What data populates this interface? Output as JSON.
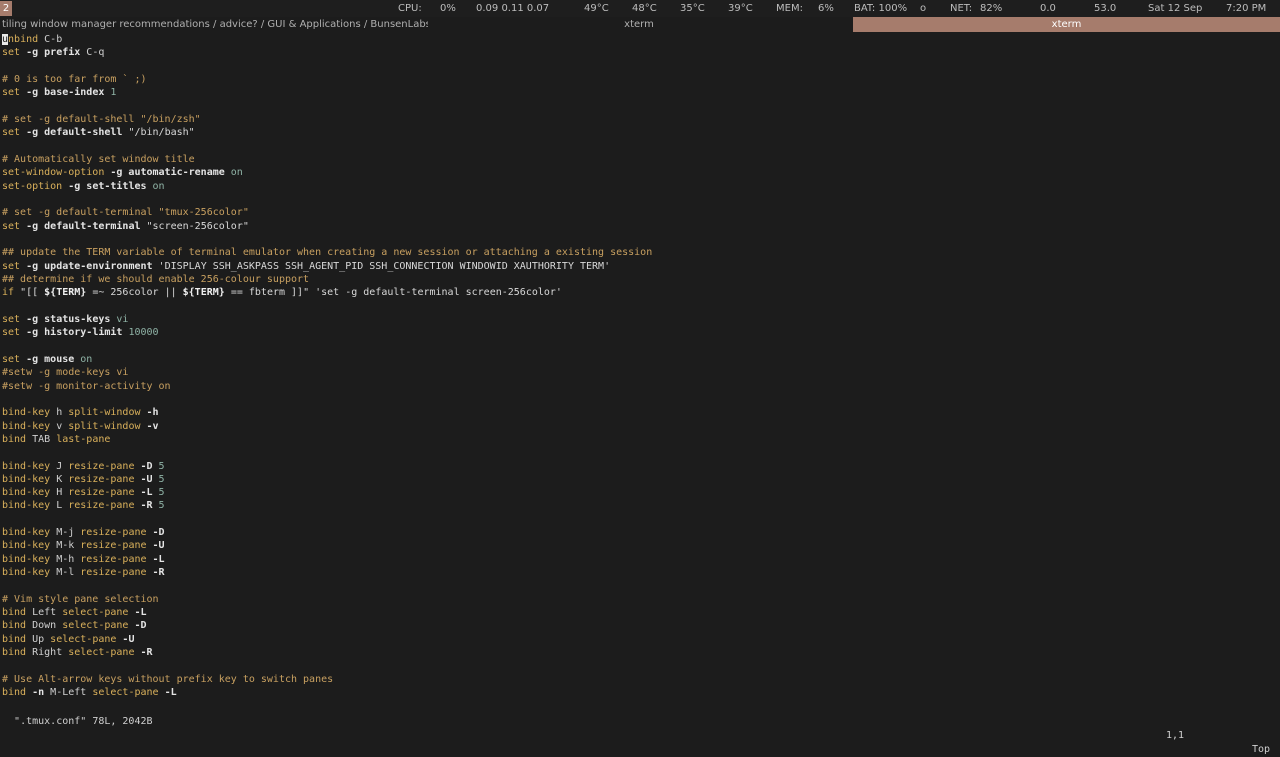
{
  "topbar": {
    "workspace": "2",
    "cpu_label": "CPU:",
    "cpu_value": "0%",
    "load": "0.09 0.11 0.07",
    "temp1": "49°C",
    "temp2": "48°C",
    "temp3": "35°C",
    "temp4": "39°C",
    "mem_label": "MEM:",
    "mem_value": "6%",
    "bat_label": "BAT: 100%",
    "bat_state": "o",
    "net_label": "NET:",
    "net_value": "82%",
    "rate1": "0.0",
    "rate2": "53.0",
    "date": "Sat 12 Sep",
    "time": "7:20 PM"
  },
  "tabs": [
    {
      "title": "tiling window manager recommendations / advice? / GUI & Applications / BunsenLabs Linux..."
    },
    {
      "title": "xterm"
    },
    {
      "title": "xterm"
    }
  ],
  "editor": {
    "lines": [
      [
        {
          "t": "u",
          "c": "cursor"
        },
        {
          "t": "nbind ",
          "c": "kw"
        },
        {
          "t": "C-b",
          "c": "txt"
        }
      ],
      [
        {
          "t": "set ",
          "c": "kw"
        },
        {
          "t": "-g prefix",
          "c": "flag"
        },
        {
          "t": " C-q",
          "c": "txt"
        }
      ],
      [],
      [
        {
          "t": "# 0 is too far from ` ;)",
          "c": "cmt"
        }
      ],
      [
        {
          "t": "set ",
          "c": "kw"
        },
        {
          "t": "-g base-index",
          "c": "flag"
        },
        {
          "t": " 1",
          "c": "val"
        }
      ],
      [],
      [
        {
          "t": "# set -g default-shell \"/bin/zsh\"",
          "c": "cmt"
        }
      ],
      [
        {
          "t": "set ",
          "c": "kw"
        },
        {
          "t": "-g default-shell",
          "c": "flag"
        },
        {
          "t": " \"/bin/bash\"",
          "c": "str"
        }
      ],
      [],
      [
        {
          "t": "# Automatically set window title",
          "c": "cmt"
        }
      ],
      [
        {
          "t": "set-window-option ",
          "c": "kw"
        },
        {
          "t": "-g automatic-rename",
          "c": "flag"
        },
        {
          "t": " on",
          "c": "val"
        }
      ],
      [
        {
          "t": "set-option ",
          "c": "kw"
        },
        {
          "t": "-g set-titles",
          "c": "flag"
        },
        {
          "t": " on",
          "c": "val"
        }
      ],
      [],
      [
        {
          "t": "# set -g default-terminal \"tmux-256color\"",
          "c": "cmt"
        }
      ],
      [
        {
          "t": "set ",
          "c": "kw"
        },
        {
          "t": "-g default-terminal",
          "c": "flag"
        },
        {
          "t": " \"screen-256color\"",
          "c": "str"
        }
      ],
      [],
      [
        {
          "t": "## update the TERM variable of terminal emulator when creating a new session or attaching a existing session",
          "c": "cmt"
        }
      ],
      [
        {
          "t": "set ",
          "c": "kw"
        },
        {
          "t": "-g update-environment",
          "c": "flag"
        },
        {
          "t": " 'DISPLAY SSH_ASKPASS SSH_AGENT_PID SSH_CONNECTION WINDOWID XAUTHORITY TERM'",
          "c": "str"
        }
      ],
      [
        {
          "t": "## determine if we should enable 256-colour support",
          "c": "cmt"
        }
      ],
      [
        {
          "t": "if ",
          "c": "kw"
        },
        {
          "t": "\"[[ ",
          "c": "str"
        },
        {
          "t": "${TERM}",
          "c": "var"
        },
        {
          "t": " =~ 256color || ",
          "c": "str"
        },
        {
          "t": "${TERM}",
          "c": "var"
        },
        {
          "t": " == fbterm ]]\" 'set -g default-terminal screen-256color'",
          "c": "str"
        }
      ],
      [],
      [
        {
          "t": "set ",
          "c": "kw"
        },
        {
          "t": "-g status-keys",
          "c": "flag"
        },
        {
          "t": " vi",
          "c": "val"
        }
      ],
      [
        {
          "t": "set ",
          "c": "kw"
        },
        {
          "t": "-g history-limit",
          "c": "flag"
        },
        {
          "t": " 10000",
          "c": "val"
        }
      ],
      [],
      [
        {
          "t": "set ",
          "c": "kw"
        },
        {
          "t": "-g mouse",
          "c": "flag"
        },
        {
          "t": " on",
          "c": "val"
        }
      ],
      [
        {
          "t": "#setw -g mode-keys vi",
          "c": "cmt"
        }
      ],
      [
        {
          "t": "#setw -g monitor-activity on",
          "c": "cmt"
        }
      ],
      [],
      [
        {
          "t": "bind-key ",
          "c": "kw"
        },
        {
          "t": "h ",
          "c": "txt"
        },
        {
          "t": "split-window ",
          "c": "kw"
        },
        {
          "t": "-h",
          "c": "flag"
        }
      ],
      [
        {
          "t": "bind-key ",
          "c": "kw"
        },
        {
          "t": "v ",
          "c": "txt"
        },
        {
          "t": "split-window ",
          "c": "kw"
        },
        {
          "t": "-v",
          "c": "flag"
        }
      ],
      [
        {
          "t": "bind ",
          "c": "kw"
        },
        {
          "t": "TAB ",
          "c": "txt"
        },
        {
          "t": "last-pane",
          "c": "kw"
        }
      ],
      [],
      [
        {
          "t": "bind-key ",
          "c": "kw"
        },
        {
          "t": "J ",
          "c": "txt"
        },
        {
          "t": "resize-pane ",
          "c": "kw"
        },
        {
          "t": "-D",
          "c": "flag"
        },
        {
          "t": " 5",
          "c": "val"
        }
      ],
      [
        {
          "t": "bind-key ",
          "c": "kw"
        },
        {
          "t": "K ",
          "c": "txt"
        },
        {
          "t": "resize-pane ",
          "c": "kw"
        },
        {
          "t": "-U",
          "c": "flag"
        },
        {
          "t": " 5",
          "c": "val"
        }
      ],
      [
        {
          "t": "bind-key ",
          "c": "kw"
        },
        {
          "t": "H ",
          "c": "txt"
        },
        {
          "t": "resize-pane ",
          "c": "kw"
        },
        {
          "t": "-L",
          "c": "flag"
        },
        {
          "t": " 5",
          "c": "val"
        }
      ],
      [
        {
          "t": "bind-key ",
          "c": "kw"
        },
        {
          "t": "L ",
          "c": "txt"
        },
        {
          "t": "resize-pane ",
          "c": "kw"
        },
        {
          "t": "-R",
          "c": "flag"
        },
        {
          "t": " 5",
          "c": "val"
        }
      ],
      [],
      [
        {
          "t": "bind-key ",
          "c": "kw"
        },
        {
          "t": "M-j ",
          "c": "txt"
        },
        {
          "t": "resize-pane ",
          "c": "kw"
        },
        {
          "t": "-D",
          "c": "flag"
        }
      ],
      [
        {
          "t": "bind-key ",
          "c": "kw"
        },
        {
          "t": "M-k ",
          "c": "txt"
        },
        {
          "t": "resize-pane ",
          "c": "kw"
        },
        {
          "t": "-U",
          "c": "flag"
        }
      ],
      [
        {
          "t": "bind-key ",
          "c": "kw"
        },
        {
          "t": "M-h ",
          "c": "txt"
        },
        {
          "t": "resize-pane ",
          "c": "kw"
        },
        {
          "t": "-L",
          "c": "flag"
        }
      ],
      [
        {
          "t": "bind-key ",
          "c": "kw"
        },
        {
          "t": "M-l ",
          "c": "txt"
        },
        {
          "t": "resize-pane ",
          "c": "kw"
        },
        {
          "t": "-R",
          "c": "flag"
        }
      ],
      [],
      [
        {
          "t": "# Vim style pane selection",
          "c": "cmt"
        }
      ],
      [
        {
          "t": "bind ",
          "c": "kw"
        },
        {
          "t": "Left ",
          "c": "txt"
        },
        {
          "t": "select-pane ",
          "c": "kw"
        },
        {
          "t": "-L",
          "c": "flag"
        }
      ],
      [
        {
          "t": "bind ",
          "c": "kw"
        },
        {
          "t": "Down ",
          "c": "txt"
        },
        {
          "t": "select-pane ",
          "c": "kw"
        },
        {
          "t": "-D",
          "c": "flag"
        }
      ],
      [
        {
          "t": "bind ",
          "c": "kw"
        },
        {
          "t": "Up ",
          "c": "txt"
        },
        {
          "t": "select-pane ",
          "c": "kw"
        },
        {
          "t": "-U",
          "c": "flag"
        }
      ],
      [
        {
          "t": "bind ",
          "c": "kw"
        },
        {
          "t": "Right ",
          "c": "txt"
        },
        {
          "t": "select-pane ",
          "c": "kw"
        },
        {
          "t": "-R",
          "c": "flag"
        }
      ],
      [],
      [
        {
          "t": "# Use Alt-arrow keys without prefix key to switch panes",
          "c": "cmt"
        }
      ],
      [
        {
          "t": "bind ",
          "c": "kw"
        },
        {
          "t": "-n",
          "c": "flag"
        },
        {
          "t": " M-Left ",
          "c": "txt"
        },
        {
          "t": "select-pane ",
          "c": "kw"
        },
        {
          "t": "-L",
          "c": "flag"
        }
      ]
    ]
  },
  "vim_status": {
    "file_info": "\".tmux.conf\" 78L, 2042B",
    "position": "1,1",
    "scroll": "Top"
  }
}
